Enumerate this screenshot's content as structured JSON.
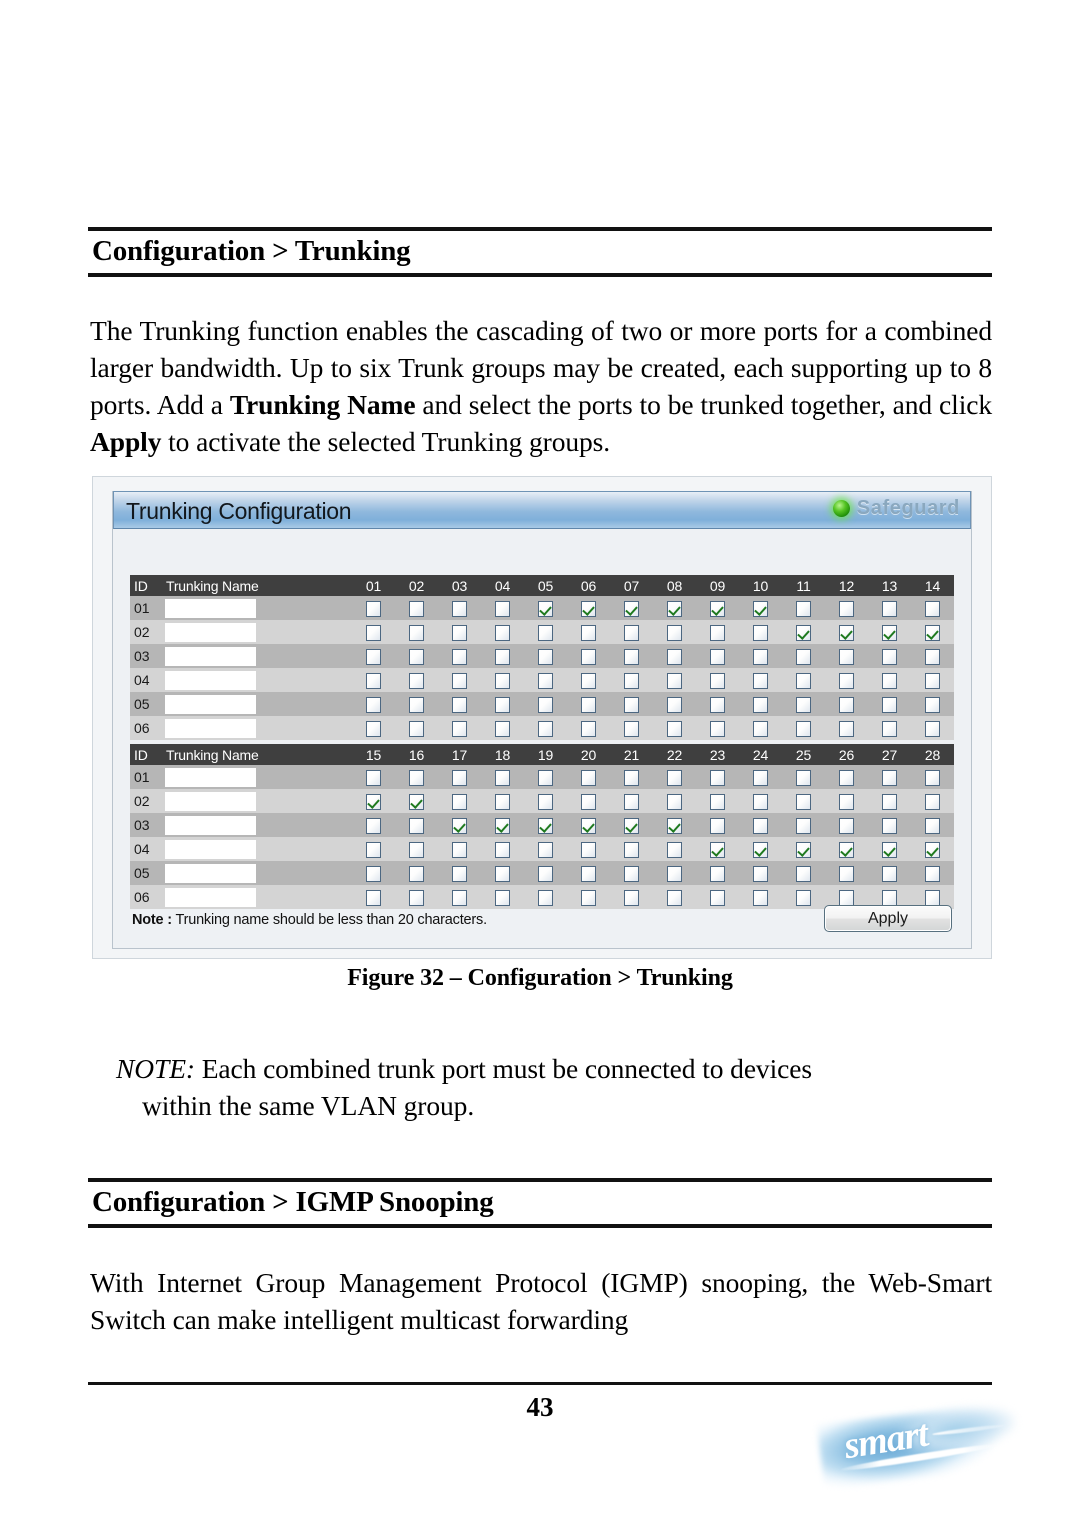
{
  "document": {
    "page_number": "43",
    "brand_logo_text": "smart"
  },
  "sections": {
    "trunking": {
      "heading": "Configuration > Trunking",
      "paragraph_parts": [
        {
          "text": "The Trunking function enables the cascading of two or more ports for a combined larger bandwidth. Up to six Trunk groups may be created, each supporting up to 8 ports. Add a ",
          "bold": false
        },
        {
          "text": "Trunking Name",
          "bold": true
        },
        {
          "text": " and select the ports to be trunked together, and click ",
          "bold": false
        },
        {
          "text": "Apply",
          "bold": true
        },
        {
          "text": " to activate the selected Trunking groups.",
          "bold": false
        }
      ],
      "figure_caption": "Figure 32 – Configuration > Trunking",
      "note_label": "NOTE:",
      "note_body": " Each combined trunk port must be connected to devices",
      "note_body_line2": "within the same VLAN group."
    },
    "igmp": {
      "heading": "Configuration > IGMP Snooping",
      "paragraph": "With Internet Group Management Protocol (IGMP) snooping, the Web-Smart Switch can make intelligent multicast forwarding"
    }
  },
  "screenshot": {
    "window_title": "Trunking Configuration",
    "safeguard_label": "Safeguard",
    "safeguard_led_color": "#55c423",
    "titlebar_color": "#8fb8dd",
    "header_row_color": "#3f3f3f",
    "row_odd_color": "#b6b6b6",
    "row_even_color": "#d4d4d4",
    "check_color": "#1f7a1f",
    "columns": {
      "id_header": "ID",
      "name_header": "Trunking Name"
    },
    "note_label": "Note :",
    "note_text": " Trunking name should be less than 20 characters.",
    "apply_label": "Apply",
    "trunking_name_placeholder": "",
    "tables": [
      {
        "id": "ports-1",
        "ports": [
          "01",
          "02",
          "03",
          "04",
          "05",
          "06",
          "07",
          "08",
          "09",
          "10",
          "11",
          "12",
          "13",
          "14"
        ],
        "rows": [
          {
            "id": "01",
            "name": "",
            "checked": [
              "05",
              "06",
              "07",
              "08",
              "09",
              "10"
            ]
          },
          {
            "id": "02",
            "name": "",
            "checked": [
              "11",
              "12",
              "13",
              "14"
            ]
          },
          {
            "id": "03",
            "name": "",
            "checked": []
          },
          {
            "id": "04",
            "name": "",
            "checked": []
          },
          {
            "id": "05",
            "name": "",
            "checked": []
          },
          {
            "id": "06",
            "name": "",
            "checked": []
          }
        ]
      },
      {
        "id": "ports-2",
        "ports": [
          "15",
          "16",
          "17",
          "18",
          "19",
          "20",
          "21",
          "22",
          "23",
          "24",
          "25",
          "26",
          "27",
          "28"
        ],
        "rows": [
          {
            "id": "01",
            "name": "",
            "checked": []
          },
          {
            "id": "02",
            "name": "",
            "checked": [
              "15",
              "16"
            ]
          },
          {
            "id": "03",
            "name": "",
            "checked": [
              "17",
              "18",
              "19",
              "20",
              "21",
              "22"
            ]
          },
          {
            "id": "04",
            "name": "",
            "checked": [
              "23",
              "24",
              "25",
              "26",
              "27",
              "28"
            ]
          },
          {
            "id": "05",
            "name": "",
            "checked": []
          },
          {
            "id": "06",
            "name": "",
            "checked": []
          }
        ]
      }
    ]
  }
}
